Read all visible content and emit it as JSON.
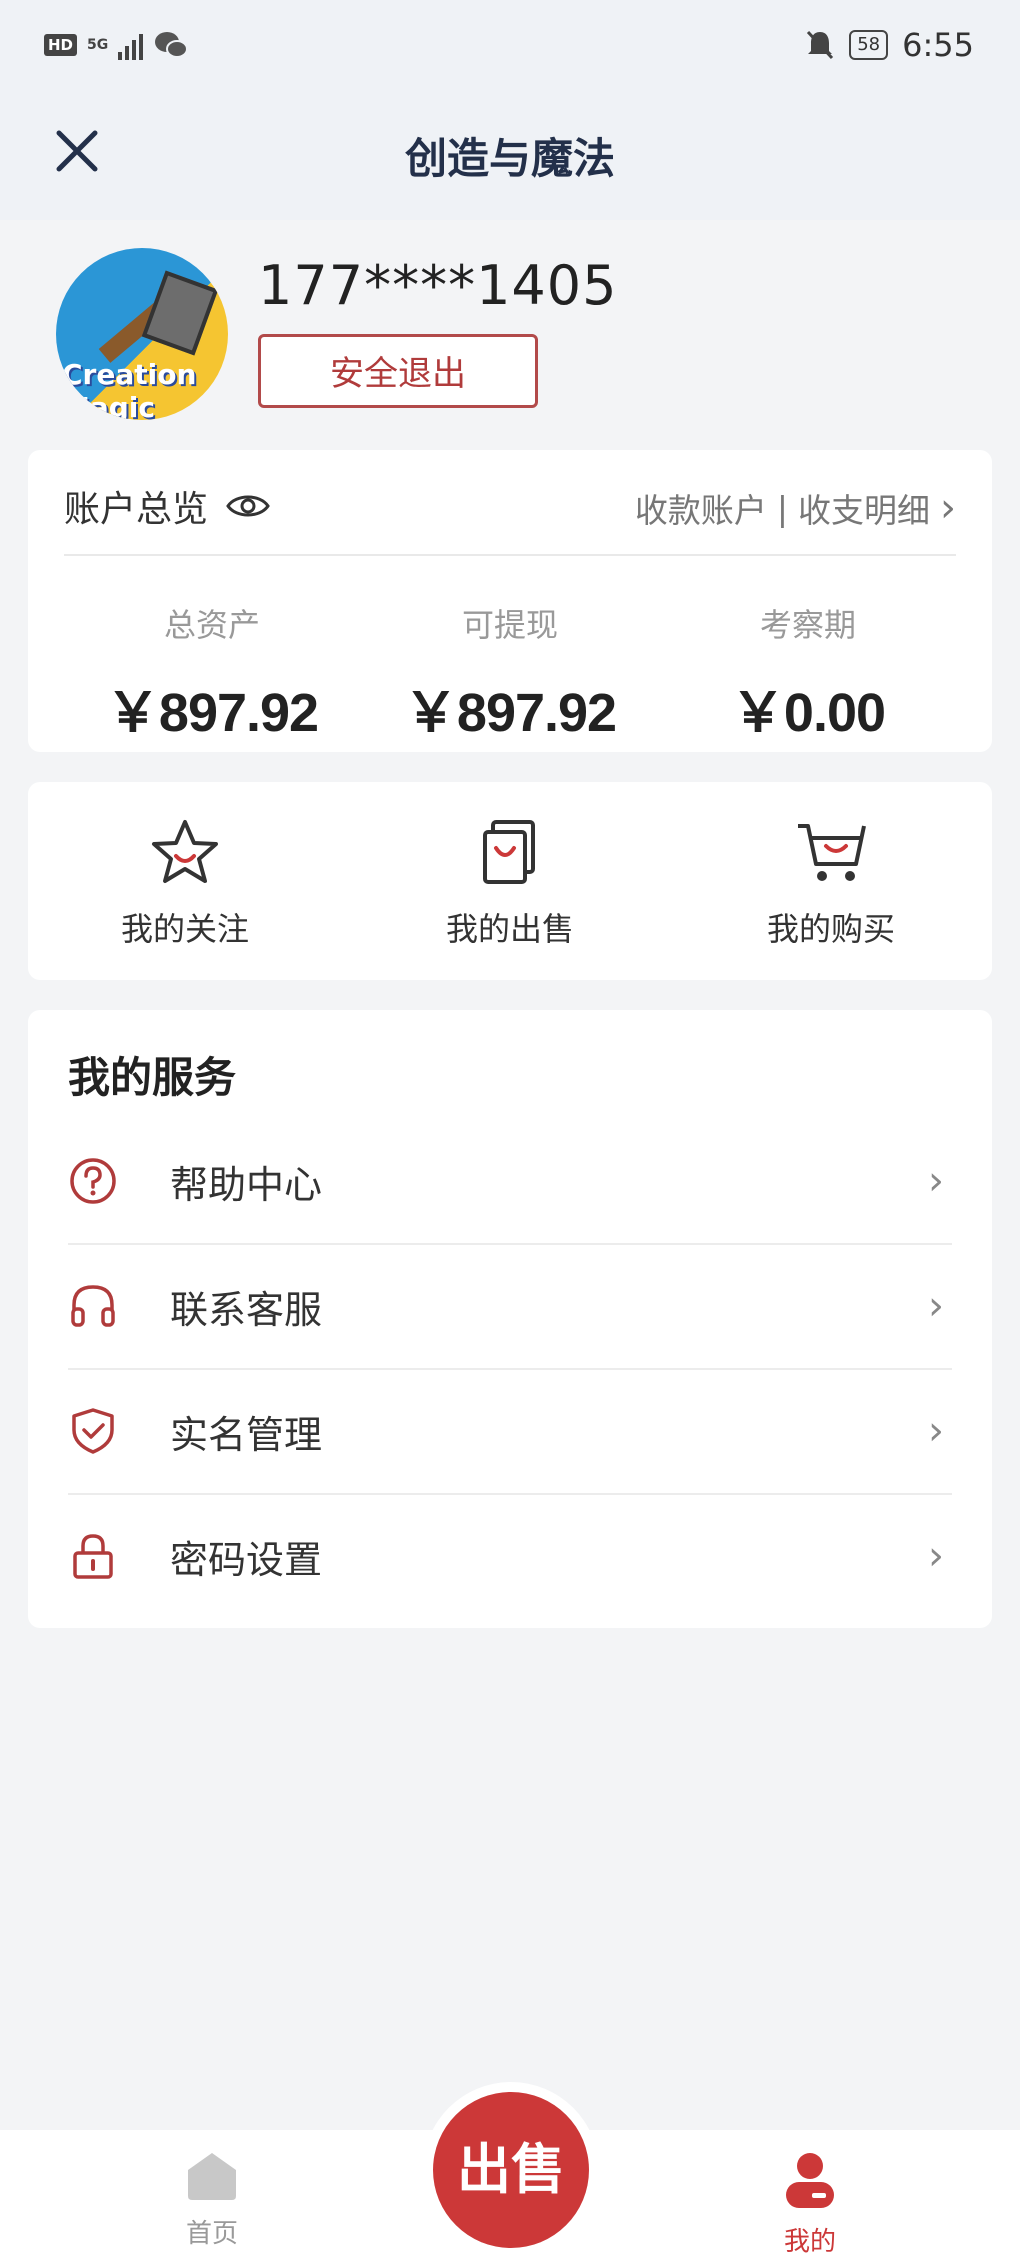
{
  "status_bar": {
    "hd": "HD",
    "network": "5G",
    "battery": "58",
    "time": "6:55"
  },
  "header": {
    "title": "创造与魔法",
    "close_icon": "close-icon"
  },
  "profile": {
    "avatar_text": "Creation Magic",
    "phone": "177****1405",
    "logout_label": "安全退出"
  },
  "account": {
    "title": "账户总览",
    "eye_icon": "eye-icon",
    "link_receive": "收款账户",
    "separator": "|",
    "link_detail": "收支明细",
    "chevron": "›",
    "stats": [
      {
        "label": "总资产",
        "amount": "￥897.92"
      },
      {
        "label": "可提现",
        "amount": "￥897.92"
      },
      {
        "label": "考察期",
        "amount": "￥0.00"
      }
    ]
  },
  "quick_actions": [
    {
      "label": "我的关注",
      "icon": "star-icon"
    },
    {
      "label": "我的出售",
      "icon": "bag-icon"
    },
    {
      "label": "我的购买",
      "icon": "cart-icon"
    }
  ],
  "services": {
    "title": "我的服务",
    "items": [
      {
        "label": "帮助中心",
        "icon": "help-icon"
      },
      {
        "label": "联系客服",
        "icon": "headset-icon"
      },
      {
        "label": "实名管理",
        "icon": "shield-icon"
      },
      {
        "label": "密码设置",
        "icon": "lock-icon"
      }
    ],
    "chevron": "›"
  },
  "tabbar": {
    "home_label": "首页",
    "sell_label": "出售",
    "mine_label": "我的"
  },
  "colors": {
    "accent": "#cc3838",
    "header_bg": "#eff2f6",
    "page_bg": "#f3f4f6",
    "title": "#23304a"
  }
}
